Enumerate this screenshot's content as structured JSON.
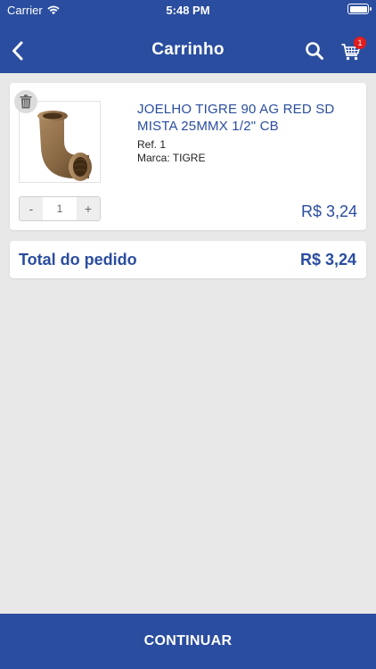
{
  "status_bar": {
    "carrier": "Carrier",
    "time": "5:48 PM"
  },
  "header": {
    "title": "Carrinho",
    "cart_badge_count": "1"
  },
  "cart_item": {
    "name": "JOELHO TIGRE 90 AG RED SD MISTA 25MMX 1/2\" CB",
    "ref": "Ref. 1",
    "brand": "Marca: TIGRE",
    "quantity": "1",
    "minus_label": "-",
    "plus_label": "+",
    "price": "R$ 3,24"
  },
  "order_total": {
    "label": "Total do pedido",
    "value": "R$ 3,24"
  },
  "footer": {
    "continue_label": "CONTINUAR"
  },
  "colors": {
    "primary": "#2a4d9f",
    "background": "#e8e8e8",
    "badge": "#e11d1d"
  },
  "icons": {
    "back": "chevron-left-icon",
    "search": "search-icon",
    "cart": "cart-icon",
    "delete": "trash-icon",
    "wifi": "wifi-icon",
    "battery": "battery-icon"
  }
}
